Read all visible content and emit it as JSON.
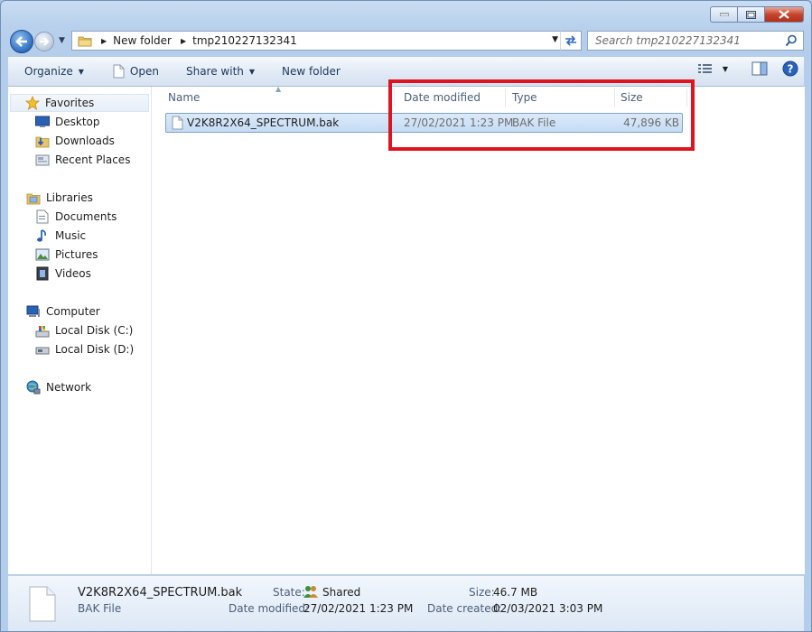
{
  "address": {
    "segments": [
      "New folder",
      "tmp210227132341"
    ]
  },
  "search": {
    "placeholder": "Search tmp210227132341"
  },
  "toolbar": {
    "organize": "Organize",
    "open": "Open",
    "share_with": "Share with",
    "new_folder": "New folder"
  },
  "sidebar": {
    "favorites": "Favorites",
    "desktop": "Desktop",
    "downloads": "Downloads",
    "recent_places": "Recent Places",
    "libraries": "Libraries",
    "documents": "Documents",
    "music": "Music",
    "pictures": "Pictures",
    "videos": "Videos",
    "computer": "Computer",
    "local_c": "Local Disk (C:)",
    "local_d": "Local Disk (D:)",
    "network": "Network"
  },
  "columns": {
    "name": "Name",
    "date_modified": "Date modified",
    "type": "Type",
    "size": "Size"
  },
  "files": [
    {
      "name": "V2K8R2X64_SPECTRUM.bak",
      "date_modified": "27/02/2021 1:23 PM",
      "type": "BAK File",
      "size": "47,896 KB"
    }
  ],
  "details": {
    "filename": "V2K8R2X64_SPECTRUM.bak",
    "filetype": "BAK File",
    "state_label": "State:",
    "state_value": "Shared",
    "date_modified_label": "Date modified:",
    "date_modified_value": "27/02/2021 1:23 PM",
    "size_label": "Size:",
    "size_value": "46.7 MB",
    "date_created_label": "Date created:",
    "date_created_value": "02/03/2021 3:03 PM"
  },
  "colors": {
    "highlight": "#e0141e",
    "selection": "#c5dcf5"
  }
}
